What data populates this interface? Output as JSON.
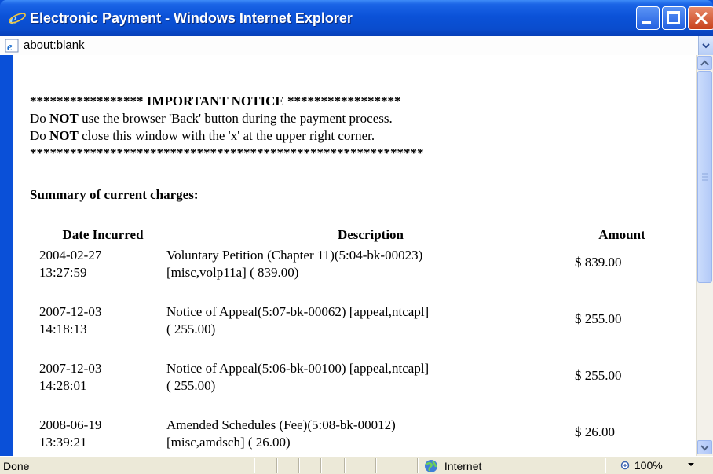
{
  "window": {
    "title": "Electronic Payment - Windows Internet Explorer",
    "colors": {
      "titlebar": "#0a4ccd",
      "close_button": "#c8411c",
      "status_bar": "#ece9d8"
    }
  },
  "address_bar": {
    "url": "about:blank"
  },
  "notice": {
    "header_stars_left": "*****************",
    "header_title": "IMPORTANT NOTICE",
    "header_stars_right": "*****************",
    "line1_prefix": "Do",
    "line1_bold": "NOT",
    "line1_suffix": "use the browser 'Back' button during the payment process.",
    "line2_prefix": "Do",
    "line2_bold": "NOT",
    "line2_suffix": "close this window with the 'x' at the upper right corner.",
    "footer_stars": "***********************************************************"
  },
  "summary_heading": "Summary of current charges:",
  "charges": {
    "columns": [
      "Date Incurred",
      "Description",
      "Amount"
    ],
    "rows": [
      {
        "date": "2004-02-27",
        "time": "13:27:59",
        "desc_line1": "Voluntary Petition (Chapter 11)(5:04-bk-00023)",
        "desc_line2": "[misc,volp11a] ( 839.00)",
        "amount": "$ 839.00"
      },
      {
        "date": "2007-12-03",
        "time": "14:18:13",
        "desc_line1": "Notice of Appeal(5:07-bk-00062) [appeal,ntcapl]",
        "desc_line2": "( 255.00)",
        "amount": "$ 255.00"
      },
      {
        "date": "2007-12-03",
        "time": "14:28:01",
        "desc_line1": "Notice of Appeal(5:06-bk-00100) [appeal,ntcapl]",
        "desc_line2": "( 255.00)",
        "amount": "$ 255.00"
      },
      {
        "date": "2008-06-19",
        "time": "13:39:21",
        "desc_line1": "Amended Schedules (Fee)(5:08-bk-00012)",
        "desc_line2": "[misc,amdsch] ( 26.00)",
        "amount": "$ 26.00"
      }
    ]
  },
  "status_bar": {
    "status": "Done",
    "zone": "Internet",
    "zoom": "100%"
  }
}
